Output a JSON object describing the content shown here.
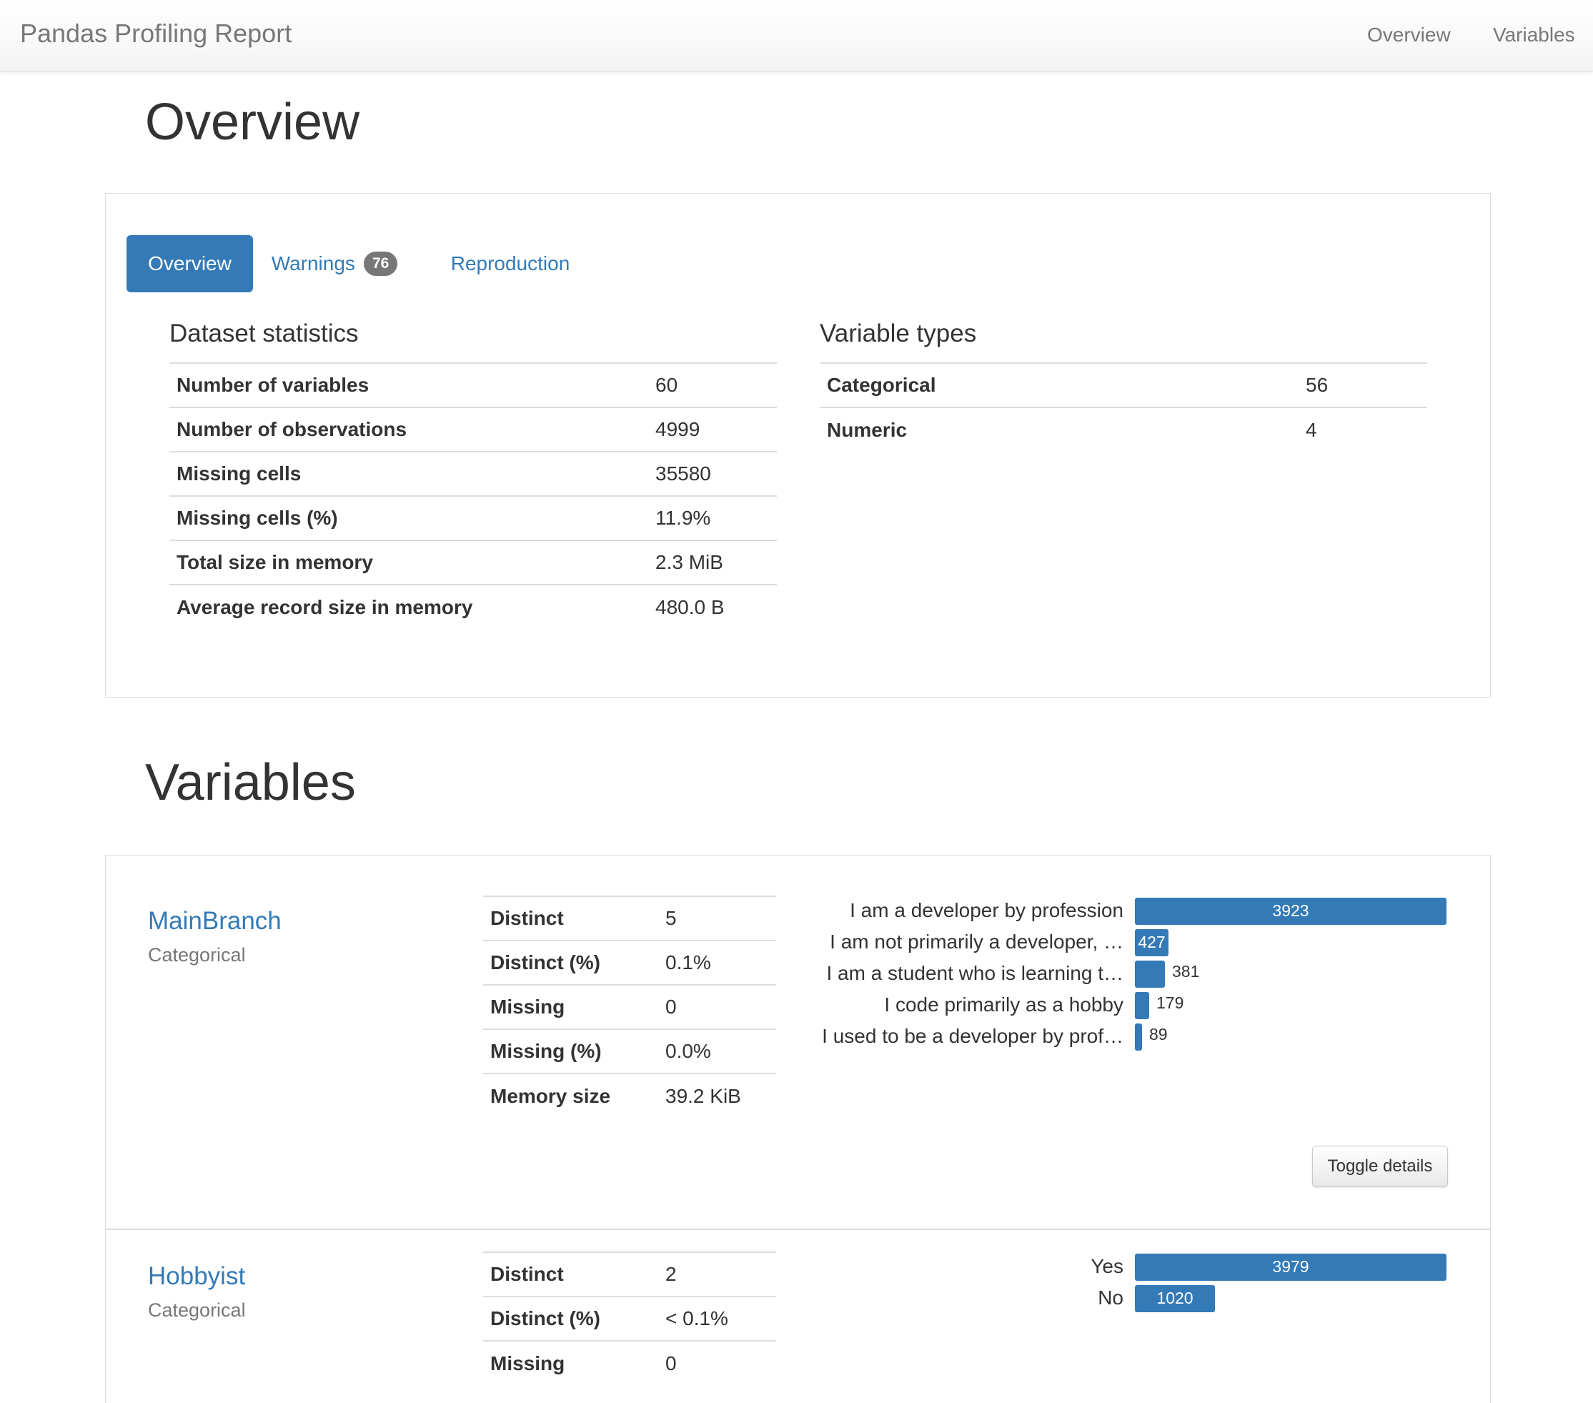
{
  "navbar": {
    "brand": "Pandas Profiling Report",
    "links": [
      "Overview",
      "Variables"
    ]
  },
  "overview": {
    "title": "Overview",
    "tabs": [
      {
        "label": "Overview",
        "active": true
      },
      {
        "label": "Warnings",
        "badge": "76",
        "active": false
      },
      {
        "label": "Reproduction",
        "active": false
      }
    ],
    "dataset_statistics": {
      "title": "Dataset statistics",
      "rows": [
        {
          "label": "Number of variables",
          "value": "60"
        },
        {
          "label": "Number of observations",
          "value": "4999"
        },
        {
          "label": "Missing cells",
          "value": "35580"
        },
        {
          "label": "Missing cells (%)",
          "value": "11.9%"
        },
        {
          "label": "Total size in memory",
          "value": "2.3 MiB"
        },
        {
          "label": "Average record size in memory",
          "value": "480.0 B"
        }
      ]
    },
    "variable_types": {
      "title": "Variable types",
      "rows": [
        {
          "label": "Categorical",
          "value": "56"
        },
        {
          "label": "Numeric",
          "value": "4"
        }
      ]
    }
  },
  "variables": {
    "title": "Variables",
    "items": [
      {
        "name": "MainBranch",
        "type": "Categorical",
        "stats": [
          {
            "label": "Distinct",
            "value": "5"
          },
          {
            "label": "Distinct (%)",
            "value": "0.1%"
          },
          {
            "label": "Missing",
            "value": "0"
          },
          {
            "label": "Missing (%)",
            "value": "0.0%"
          },
          {
            "label": "Memory size",
            "value": "39.2 KiB"
          }
        ],
        "frequencies": [
          {
            "label": "I am a developer by profession",
            "count": 3923,
            "count_label": "3923"
          },
          {
            "label": "I am not primarily a developer, …",
            "count": 427,
            "count_label": "427"
          },
          {
            "label": "I am a student who is learning t…",
            "count": 381,
            "count_label": "381"
          },
          {
            "label": "I code primarily as a hobby",
            "count": 179,
            "count_label": "179"
          },
          {
            "label": "I used to be a developer by prof…",
            "count": 89,
            "count_label": "89"
          }
        ],
        "toggle_label": "Toggle details"
      },
      {
        "name": "Hobbyist",
        "type": "Categorical",
        "stats": [
          {
            "label": "Distinct",
            "value": "2"
          },
          {
            "label": "Distinct (%)",
            "value": "< 0.1%"
          },
          {
            "label": "Missing",
            "value": "0"
          }
        ],
        "frequencies": [
          {
            "label": "Yes",
            "count": 3979,
            "count_label": "3979"
          },
          {
            "label": "No",
            "count": 1020,
            "count_label": "1020"
          }
        ]
      }
    ]
  },
  "colors": {
    "accent": "#337ab7",
    "badge": "#777777",
    "muted_text": "#777777",
    "border": "#dddddd"
  }
}
